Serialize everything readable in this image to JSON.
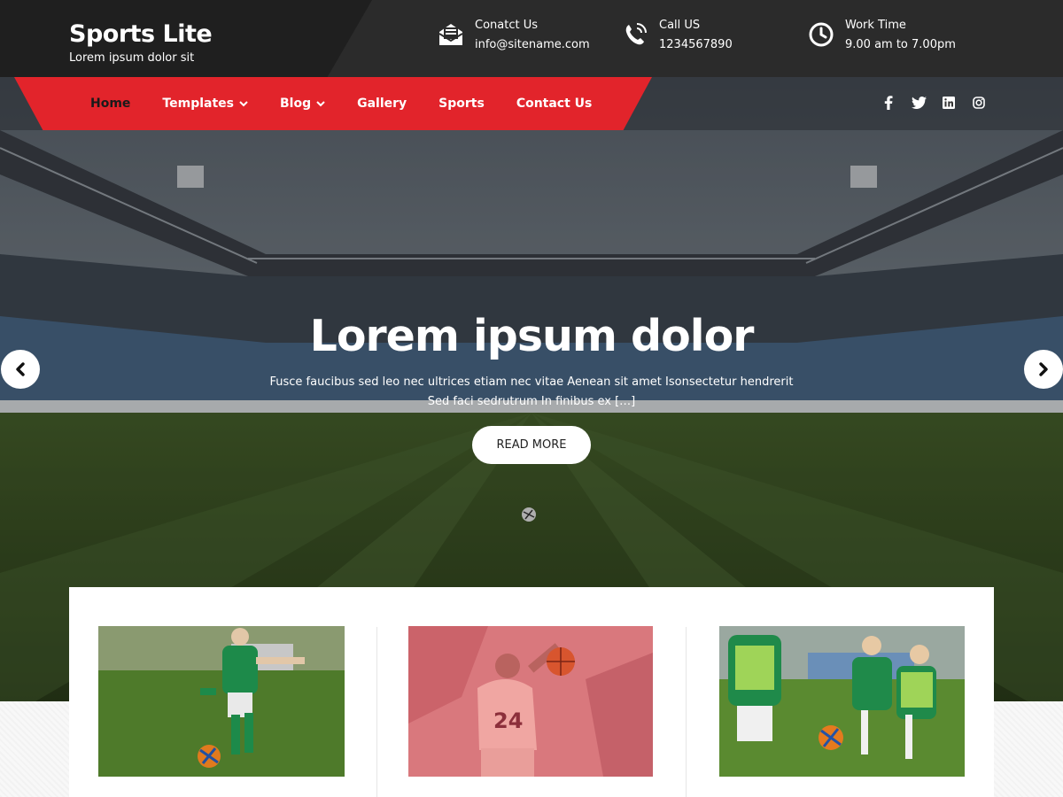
{
  "site": {
    "title": "Sports Lite",
    "tagline": "Lorem ipsum dolor sit"
  },
  "header_info": [
    {
      "icon": "envelope-open-icon",
      "label": "Conatct Us",
      "value": "info@sitename.com"
    },
    {
      "icon": "phone-icon",
      "label": "Call US",
      "value": "1234567890"
    },
    {
      "icon": "clock-icon",
      "label": "Work Time",
      "value": "9.00 am to 7.00pm"
    }
  ],
  "nav": {
    "items": [
      {
        "label": "Home",
        "active": true
      },
      {
        "label": "Templates",
        "dropdown": true
      },
      {
        "label": "Blog",
        "dropdown": true
      },
      {
        "label": "Gallery"
      },
      {
        "label": "Sports"
      },
      {
        "label": "Contact Us"
      }
    ]
  },
  "social": [
    "facebook-icon",
    "twitter-icon",
    "linkedin-icon",
    "instagram-icon"
  ],
  "hero": {
    "title": "Lorem ipsum dolor",
    "description": "Fusce faucibus sed leo nec ultrices etiam nec vitae Aenean sit amet Isonsectetur hendrerit Sed faci sedrutrum In finibus ex […]",
    "button": "READ MORE"
  },
  "colors": {
    "accent": "#e2242b",
    "topbar": "#2b2b2b"
  }
}
